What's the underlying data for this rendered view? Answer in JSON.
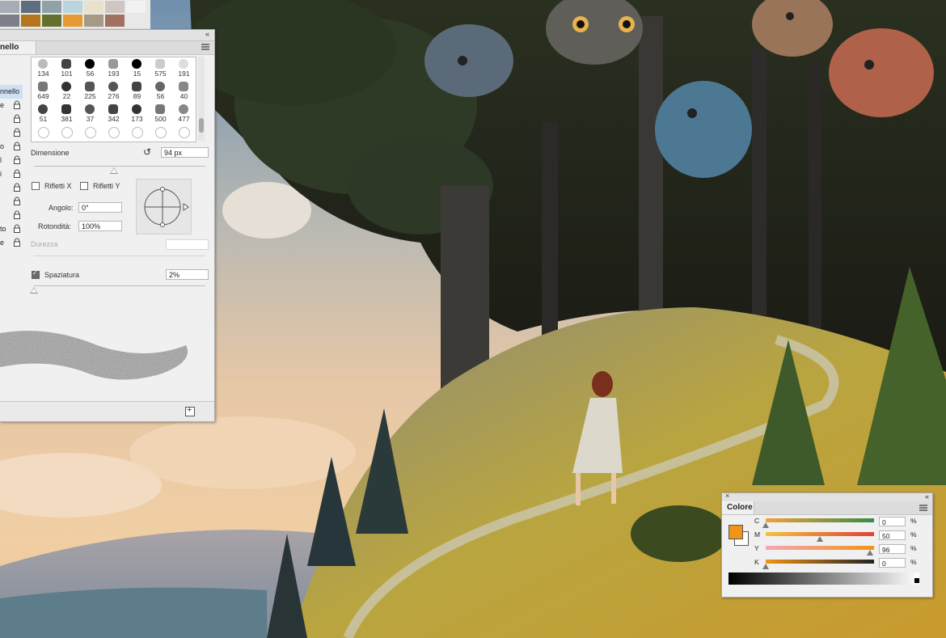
{
  "colors": {
    "swatches_row1": [
      "#a8acb5",
      "#5d6f7e",
      "#8fa2a8",
      "#b8d6dc",
      "#e9e1c9",
      "#cfc6c2",
      "#f2f2f2"
    ],
    "swatches_row2": [
      "#7c7f87",
      "#b4751c",
      "#64712e",
      "#e59a32",
      "#a49a85",
      "#a07060"
    ],
    "foreground": "#f29418",
    "panel_bg": "#f0f0f0"
  },
  "brush_panel": {
    "tab_label": "nello",
    "brush_list": [
      {
        "label": "nnello",
        "selected": true
      },
      {
        "label": "e"
      },
      {
        "label": ""
      },
      {
        "label": ""
      },
      {
        "label": "o"
      },
      {
        "label": "l"
      },
      {
        "label": "i"
      },
      {
        "label": ""
      },
      {
        "label": ""
      },
      {
        "label": ""
      },
      {
        "label": "to"
      },
      {
        "label": "e"
      }
    ],
    "tips": [
      {
        "num": "134"
      },
      {
        "num": "101"
      },
      {
        "num": "56"
      },
      {
        "num": "193"
      },
      {
        "num": "15"
      },
      {
        "num": "575"
      },
      {
        "num": "191"
      },
      {
        "num": "649"
      },
      {
        "num": "22"
      },
      {
        "num": "225"
      },
      {
        "num": "276"
      },
      {
        "num": "89"
      },
      {
        "num": "56"
      },
      {
        "num": "40"
      },
      {
        "num": "51"
      },
      {
        "num": "381"
      },
      {
        "num": "37"
      },
      {
        "num": "342"
      },
      {
        "num": "173"
      },
      {
        "num": "500"
      },
      {
        "num": "477"
      },
      {
        "num": ""
      },
      {
        "num": ""
      },
      {
        "num": ""
      },
      {
        "num": ""
      },
      {
        "num": ""
      },
      {
        "num": ""
      },
      {
        "num": ""
      }
    ],
    "size_label": "Dimensione",
    "size_value": "94 px",
    "flip_x_label": "Rifletti X",
    "flip_y_label": "Rifletti Y",
    "angle_label": "Angolo:",
    "angle_value": "0°",
    "roundness_label": "Rotondità:",
    "roundness_value": "100%",
    "hardness_label": "Durezza",
    "spacing_label": "Spaziatura",
    "spacing_value": "2%",
    "spacing_checked": true
  },
  "color_panel": {
    "tab_label": "Colore",
    "close_glyph": "×",
    "collapse_glyph": "«",
    "channels": [
      {
        "letter": "C",
        "value": "0",
        "unit": "%",
        "fraction": 0.0
      },
      {
        "letter": "M",
        "value": "50",
        "unit": "%",
        "fraction": 0.5
      },
      {
        "letter": "Y",
        "value": "96",
        "unit": "%",
        "fraction": 0.96
      },
      {
        "letter": "K",
        "value": "0",
        "unit": "%",
        "fraction": 0.0
      }
    ]
  },
  "icons": {
    "reset": "↺",
    "collapse": "«"
  }
}
